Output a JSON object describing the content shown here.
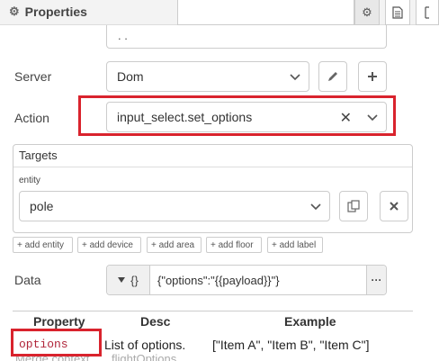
{
  "header": {
    "title": "Properties"
  },
  "top_field": {
    "value": ". ."
  },
  "server": {
    "label": "Server",
    "value": "Dom"
  },
  "action": {
    "label": "Action",
    "value": "input_select.set_options"
  },
  "targets": {
    "title": "Targets",
    "entity_label": "entity",
    "entity_value": "pole",
    "add_buttons": [
      "+ add entity",
      "+ add device",
      "+ add area",
      "+ add floor",
      "+ add label"
    ]
  },
  "data": {
    "label": "Data",
    "type_symbol": "{}",
    "value": "{\"options\":\"{{payload}}\"}",
    "more": "···"
  },
  "table": {
    "headers": [
      "Property",
      "Desc",
      "Example"
    ],
    "row": {
      "property": "options",
      "desc": "List of options.",
      "example": "[\"Item A\", \"Item B\", \"Item C\"]"
    },
    "faded": {
      "left": "Merge context",
      "right": "flightOptions"
    }
  },
  "colors": {
    "highlight": "#d9232d",
    "code": "#b0253a"
  }
}
